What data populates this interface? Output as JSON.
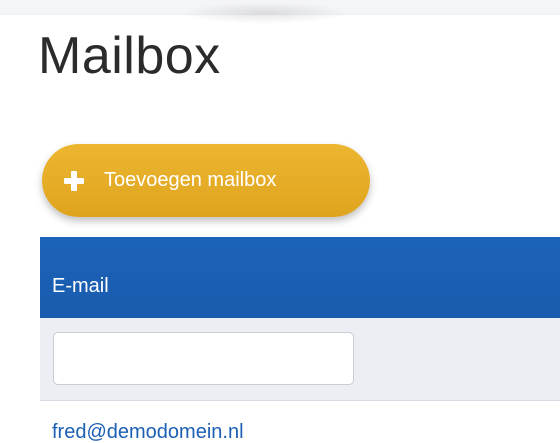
{
  "page": {
    "title": "Mailbox"
  },
  "toolbar": {
    "add_label": "Toevoegen mailbox"
  },
  "table": {
    "columns": [
      "E-mail"
    ],
    "filter": {
      "value": "",
      "placeholder": ""
    },
    "rows": [
      {
        "email": "fred@demodomein.nl"
      }
    ]
  },
  "colors": {
    "accent": "#e3a924",
    "header": "#1b62b8",
    "link": "#1d5fb3"
  },
  "icons": {
    "add": "plus-icon"
  }
}
